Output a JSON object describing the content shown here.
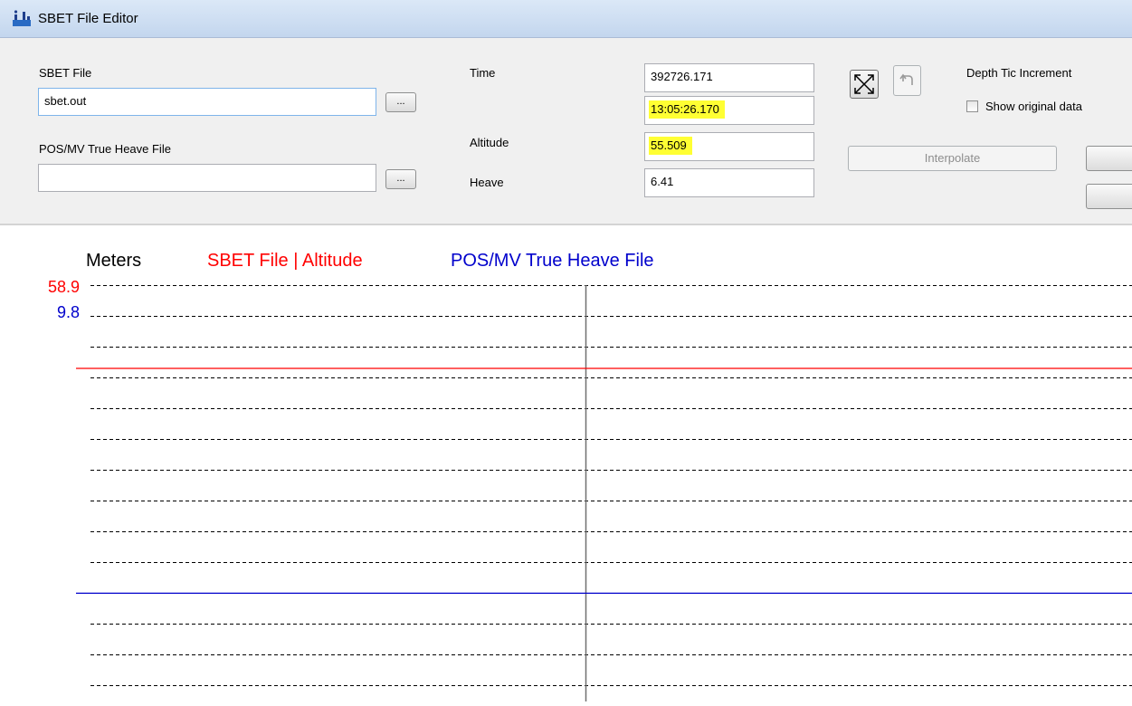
{
  "window": {
    "title": "SBET File Editor",
    "app_icon": "sbet-app-icon"
  },
  "form": {
    "sbet_file_label": "SBET File",
    "sbet_file_value": "sbet.out",
    "heave_file_label": "POS/MV True Heave File",
    "heave_file_value": "",
    "browse_label": "...",
    "time_label": "Time",
    "time_value": "392726.171",
    "clock_value": "13:05:26.170",
    "altitude_label": "Altitude",
    "altitude_value": "55.509",
    "heave_label": "Heave",
    "heave_value": "6.41",
    "depth_tic_label": "Depth Tic Increment",
    "show_original_label": "Show original data",
    "show_original_checked": false,
    "interpolate_label": "Interpolate",
    "highlight_color": "#ffff33"
  },
  "toolbar": {
    "expand_icon": "expand-arrows-icon",
    "undo_icon": "undo-icon"
  },
  "chart_data": {
    "type": "line",
    "units_label": "Meters",
    "series": [
      {
        "name": "SBET File | Altitude",
        "color": "#ff0000",
        "axis_top": "58.9",
        "value_fraction_from_top": 0.2
      },
      {
        "name": "POS/MV True Heave File",
        "color": "#0000cc",
        "axis_top": "9.8",
        "value_fraction_from_top": 0.74
      }
    ],
    "grid": "dashed",
    "cursor": "vertical line at current time"
  }
}
